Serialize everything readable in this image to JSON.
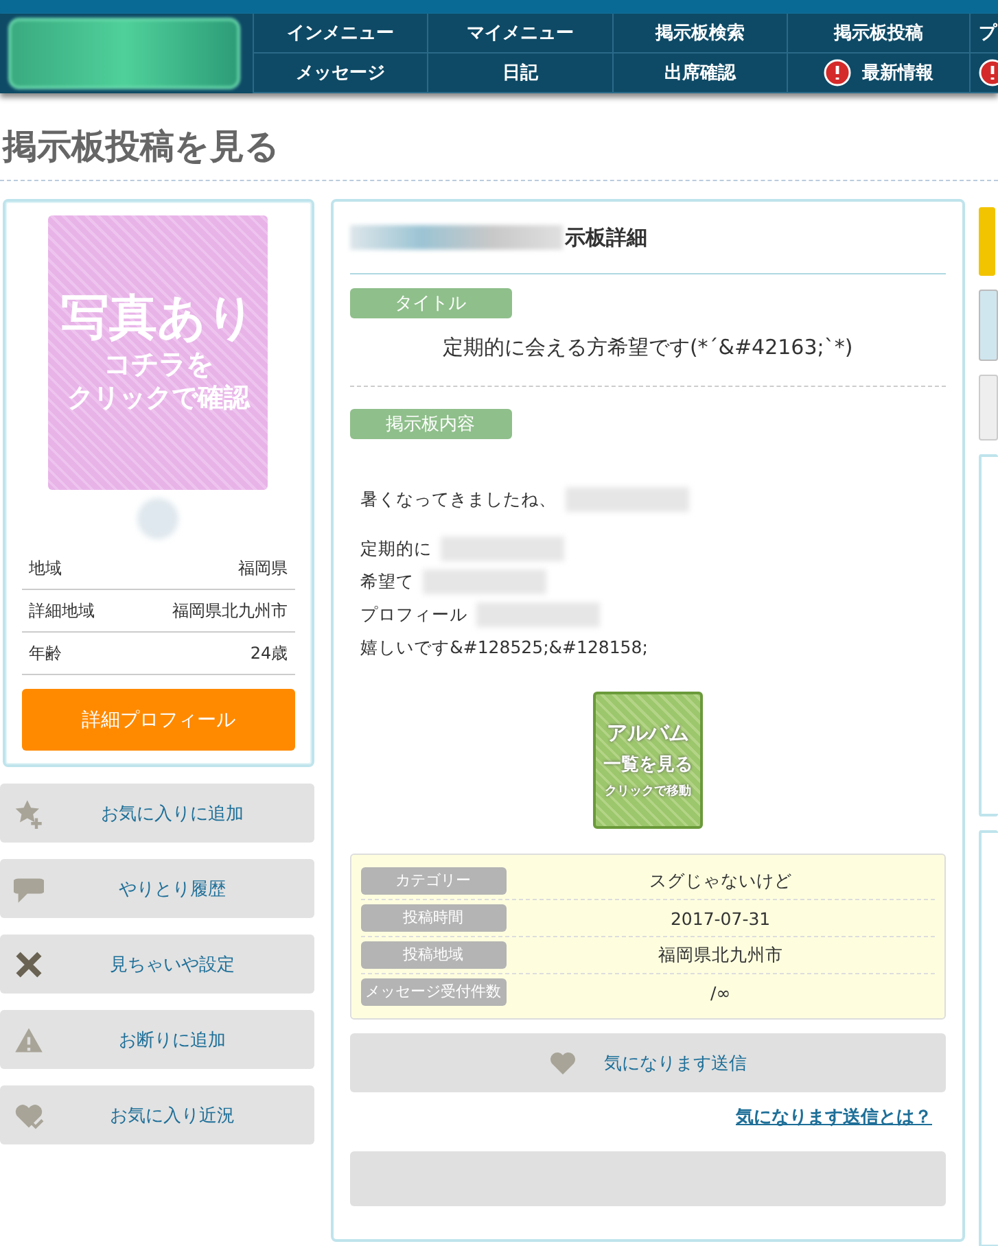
{
  "nav": {
    "rows": [
      [
        {
          "label": "インメニュー",
          "alert": false
        },
        {
          "label": "マイメニュー",
          "alert": false
        },
        {
          "label": "掲示板検索",
          "alert": false
        },
        {
          "label": "掲示板投稿",
          "alert": false
        },
        {
          "label": "プ",
          "alert": false
        }
      ],
      [
        {
          "label": "メッセージ",
          "alert": false
        },
        {
          "label": "日記",
          "alert": false
        },
        {
          "label": "出席確認",
          "alert": false
        },
        {
          "label": "最新情報",
          "alert": true
        },
        {
          "alert": true
        }
      ]
    ]
  },
  "page_title": "掲示板投稿を見る",
  "profile": {
    "photo_lines": [
      "写真あり",
      "コチラを",
      "クリックで確認"
    ],
    "fields": [
      {
        "label": "地域",
        "value": "福岡県"
      },
      {
        "label": "詳細地域",
        "value": "福岡県北九州市"
      },
      {
        "label": "年齢",
        "value": "24歳"
      }
    ],
    "button": "詳細プロフィール"
  },
  "actions": [
    {
      "label": "お気に入りに追加",
      "kind": "star"
    },
    {
      "label": "やりとり履歴",
      "kind": "chat"
    },
    {
      "label": "見ちゃいや設定",
      "kind": "cross"
    },
    {
      "label": "お断りに追加",
      "kind": "warning"
    },
    {
      "label": "お気に入り近況",
      "kind": "heart-check"
    }
  ],
  "detail": {
    "heading": "示板詳細",
    "title_tag": "タイトル",
    "title": "定期的に会える方希望です(*´&#42163;`*)",
    "content_tag": "掲示板内容",
    "content_lines": [
      {
        "kind": "text",
        "text": "暑くなってきましたね、",
        "redacted": true
      },
      {
        "kind": "blank"
      },
      {
        "kind": "text",
        "text": "定期的に",
        "redacted": true
      },
      {
        "kind": "text",
        "text": "希望て",
        "redacted": true
      },
      {
        "kind": "text",
        "text": "プロフィール",
        "redacted": true
      },
      {
        "kind": "text",
        "text": "嬉しいです&#128525;&#128158;",
        "redacted": false
      }
    ],
    "album_lines": [
      "アルバム",
      "一覧を見る",
      "クリックで移動"
    ],
    "info": [
      {
        "label": "カテゴリー",
        "value": "スグじゃないけど"
      },
      {
        "label": "投稿時間",
        "value": "2017-07-31"
      },
      {
        "label": "投稿地域",
        "value": "福岡県北九州市"
      },
      {
        "label": "メッセージ受付件数",
        "value": "/∞"
      }
    ],
    "send_button": "気になります送信",
    "help_link": "気になります送信とは？"
  }
}
